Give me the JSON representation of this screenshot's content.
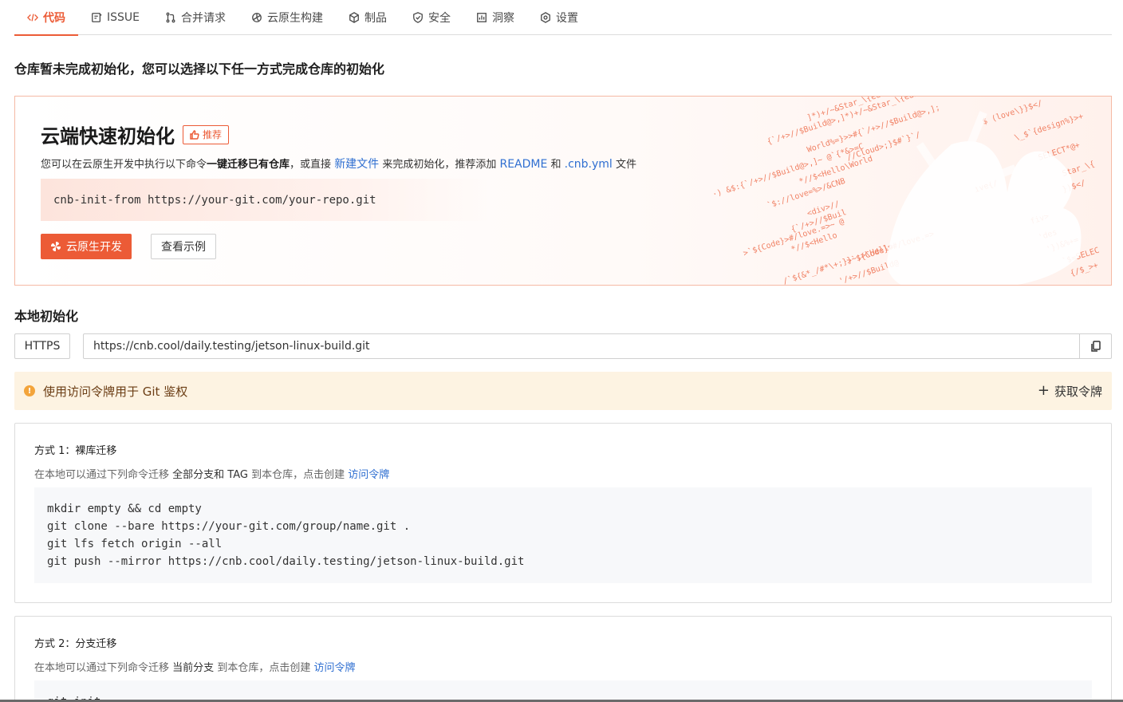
{
  "tabs": [
    {
      "label": "代码",
      "icon": "code-icon",
      "active": true
    },
    {
      "label": "ISSUE",
      "icon": "issue-icon",
      "active": false
    },
    {
      "label": "合并请求",
      "icon": "merge-request-icon",
      "active": false
    },
    {
      "label": "云原生构建",
      "icon": "build-icon",
      "active": false
    },
    {
      "label": "制品",
      "icon": "package-icon",
      "active": false
    },
    {
      "label": "安全",
      "icon": "shield-icon",
      "active": false
    },
    {
      "label": "洞察",
      "icon": "chart-icon",
      "active": false
    },
    {
      "label": "设置",
      "icon": "gear-icon",
      "active": false
    }
  ],
  "notice_title": "仓库暂未完成初始化，您可以选择以下任一方式完成仓库的初始化",
  "cloud": {
    "title": "云端快速初始化",
    "badge": "推荐",
    "desc_part1": "您可以在云原生开发中执行以下命令",
    "desc_bold": "一键迁移已有仓库",
    "desc_part2": "，或直接",
    "desc_link_new_file": "新建文件",
    "desc_part3": "来完成初始化，推荐添加",
    "desc_link_readme": "README",
    "desc_part4": "和",
    "desc_link_cnbyml": ".cnb.yml",
    "desc_part5": "文件",
    "command": "cnb-init-from https://your-git.com/your-repo.git",
    "primary_button": "云原生开发",
    "secondary_button": "查看示例",
    "bg_snippets": [
      "]*)+/~&Star_\\{edit/",
      "{`/+>//$Build@>,]*)+/~&Star_\\{edit/",
      "World%=}>>#{`/+>//$Build@>,];",
      "//Cloud>;}$#`}`/ ",
      "//·) &$:{`/+>//$Build@>,]~ @`{*&>=C",
      "*//$<Hello\\World",
      "`$://love=%>/&CNB",
      "<div>//",
      "{`/+>//$Buil",
      ">`${Code}>#/love.=>~ @",
      "*//$<Hello",
      ">`${Code}>#/love.=>",
      "/`${&*_/#*\\+;}}~;>\\Hello",
      "'/+>//$Build@",
      "$ (love\\}}$</",
      "\\_$`{design%}>+",
      "SELECT*@+",
      "Star_\\{",
      "})$</",
      "ive{/",
      "fiv>",
      "'des",
      "'})&%+=",
      "`$=SELEC",
      "{/$_>+"
    ]
  },
  "local": {
    "title": "本地初始化",
    "protocol": "HTTPS",
    "url": "https://cnb.cool/daily.testing/jetson-linux-build.git"
  },
  "alert": {
    "text": "使用访问令牌用于 Git 鉴权",
    "action": "获取令牌"
  },
  "methods": [
    {
      "title": "方式 1：裸库迁移",
      "desc_part1": "在本地可以通过下列命令迁移",
      "desc_bold": "全部分支和 TAG",
      "desc_part2": "到本仓库，点击创建",
      "desc_link": "访问令牌",
      "code": [
        "mkdir empty && cd empty",
        "git clone --bare https://your-git.com/group/name.git .",
        "git lfs fetch origin --all",
        "git push --mirror https://cnb.cool/daily.testing/jetson-linux-build.git"
      ]
    },
    {
      "title": "方式 2：分支迁移",
      "desc_part1": "在本地可以通过下列命令迁移",
      "desc_bold": "当前分支",
      "desc_part2": "到本仓库，点击创建",
      "desc_link": "访问令牌",
      "code": [
        "git init"
      ]
    }
  ],
  "colors": {
    "accent": "#ec5b36",
    "link": "#2f6fd1",
    "alert_bg": "#fdf3e2",
    "code_bg": "#f7f8fa"
  }
}
